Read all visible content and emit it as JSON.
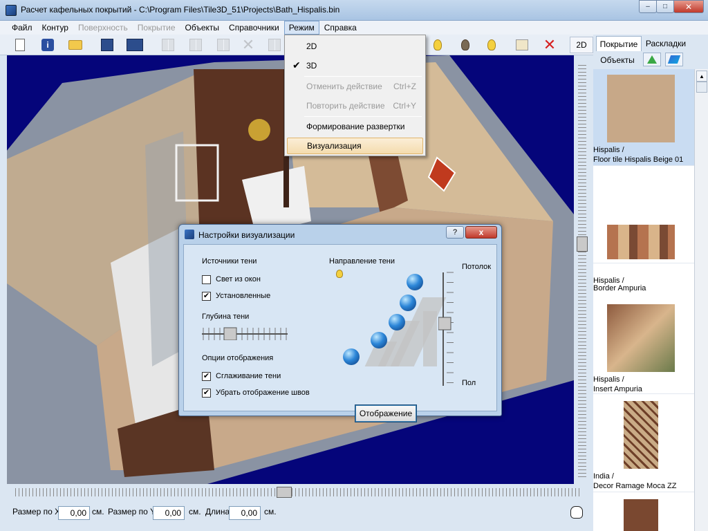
{
  "window": {
    "title": "Расчет кафельных покрытий - C:\\Program Files\\Tile3D_51\\Projects\\Bath_Hispalis.bin"
  },
  "menubar": [
    {
      "label": "Файл",
      "disabled": false
    },
    {
      "label": "Контур",
      "disabled": false
    },
    {
      "label": "Поверхность",
      "disabled": true
    },
    {
      "label": "Покрытие",
      "disabled": true
    },
    {
      "label": "Объекты",
      "disabled": false
    },
    {
      "label": "Справочники",
      "disabled": false
    },
    {
      "label": "Режим",
      "disabled": false,
      "active": true
    },
    {
      "label": "Справка",
      "disabled": false
    }
  ],
  "toolbar": {
    "mode_2d_label": "2D"
  },
  "mode_menu": {
    "items": [
      {
        "label": "2D",
        "checked": false,
        "disabled": false,
        "shortcut": ""
      },
      {
        "label": "3D",
        "checked": true,
        "disabled": false,
        "shortcut": ""
      },
      {
        "label": "Отменить действие",
        "checked": false,
        "disabled": true,
        "shortcut": "Ctrl+Z"
      },
      {
        "label": "Повторить действие",
        "checked": false,
        "disabled": true,
        "shortcut": "Ctrl+Y"
      },
      {
        "label": "Формирование развертки",
        "checked": false,
        "disabled": false,
        "shortcut": ""
      },
      {
        "label": "Визуализация",
        "checked": false,
        "disabled": false,
        "shortcut": "",
        "highlighted": true
      }
    ]
  },
  "dialog": {
    "title": "Настройки визуализации",
    "help_label": "?",
    "close_label": "x",
    "shadow_sources_label": "Источники тени",
    "window_light_label": "Свет из окон",
    "window_light_checked": false,
    "installed_label": "Установленные",
    "installed_checked": true,
    "shadow_depth_label": "Глубина тени",
    "shadow_depth_level": 0.3,
    "display_options_label": "Опции отображения",
    "smoothing_label": "Сглаживание тени",
    "smoothing_checked": true,
    "hide_seams_label": "Убрать отображение швов",
    "hide_seams_checked": true,
    "direction_label": "Направление тени",
    "ceiling_label": "Потолок",
    "floor_label": "Пол",
    "height_level": 0.55,
    "view_button_label": "Отображение",
    "check_mark": "✔"
  },
  "right_panel": {
    "tabs": [
      "Покрытие",
      "Раскладки",
      "Объекты"
    ],
    "selected_tab": 0,
    "tiles": [
      {
        "line1": "Hispalis /",
        "line2": "Floor tile Hispalis Beige 01",
        "selected": true,
        "color": "#c7a888"
      },
      {
        "line1": "Hispalis /",
        "line2": "Border Ampuria",
        "selected": false,
        "color": "#b5734f"
      },
      {
        "line1": "Hispalis /",
        "line2": "Insert Ampuria",
        "selected": false,
        "color": "#9c6a4c"
      },
      {
        "line1": "India /",
        "line2": "Decor Ramage Moca ZZ",
        "selected": false,
        "color": "#c9ab86"
      }
    ]
  },
  "statusbar": {
    "size_x_label": "Размер по X",
    "size_x_value": "0,00",
    "size_y_label": "Размер по Y",
    "size_y_value": "0,00",
    "length_label": "Длина",
    "length_value": "0,00",
    "unit": "см."
  },
  "colors": {
    "viewport_bg": "#05057a",
    "menu_highlight": "#f4dcae",
    "dialog_bg": "#d8e6f4"
  }
}
